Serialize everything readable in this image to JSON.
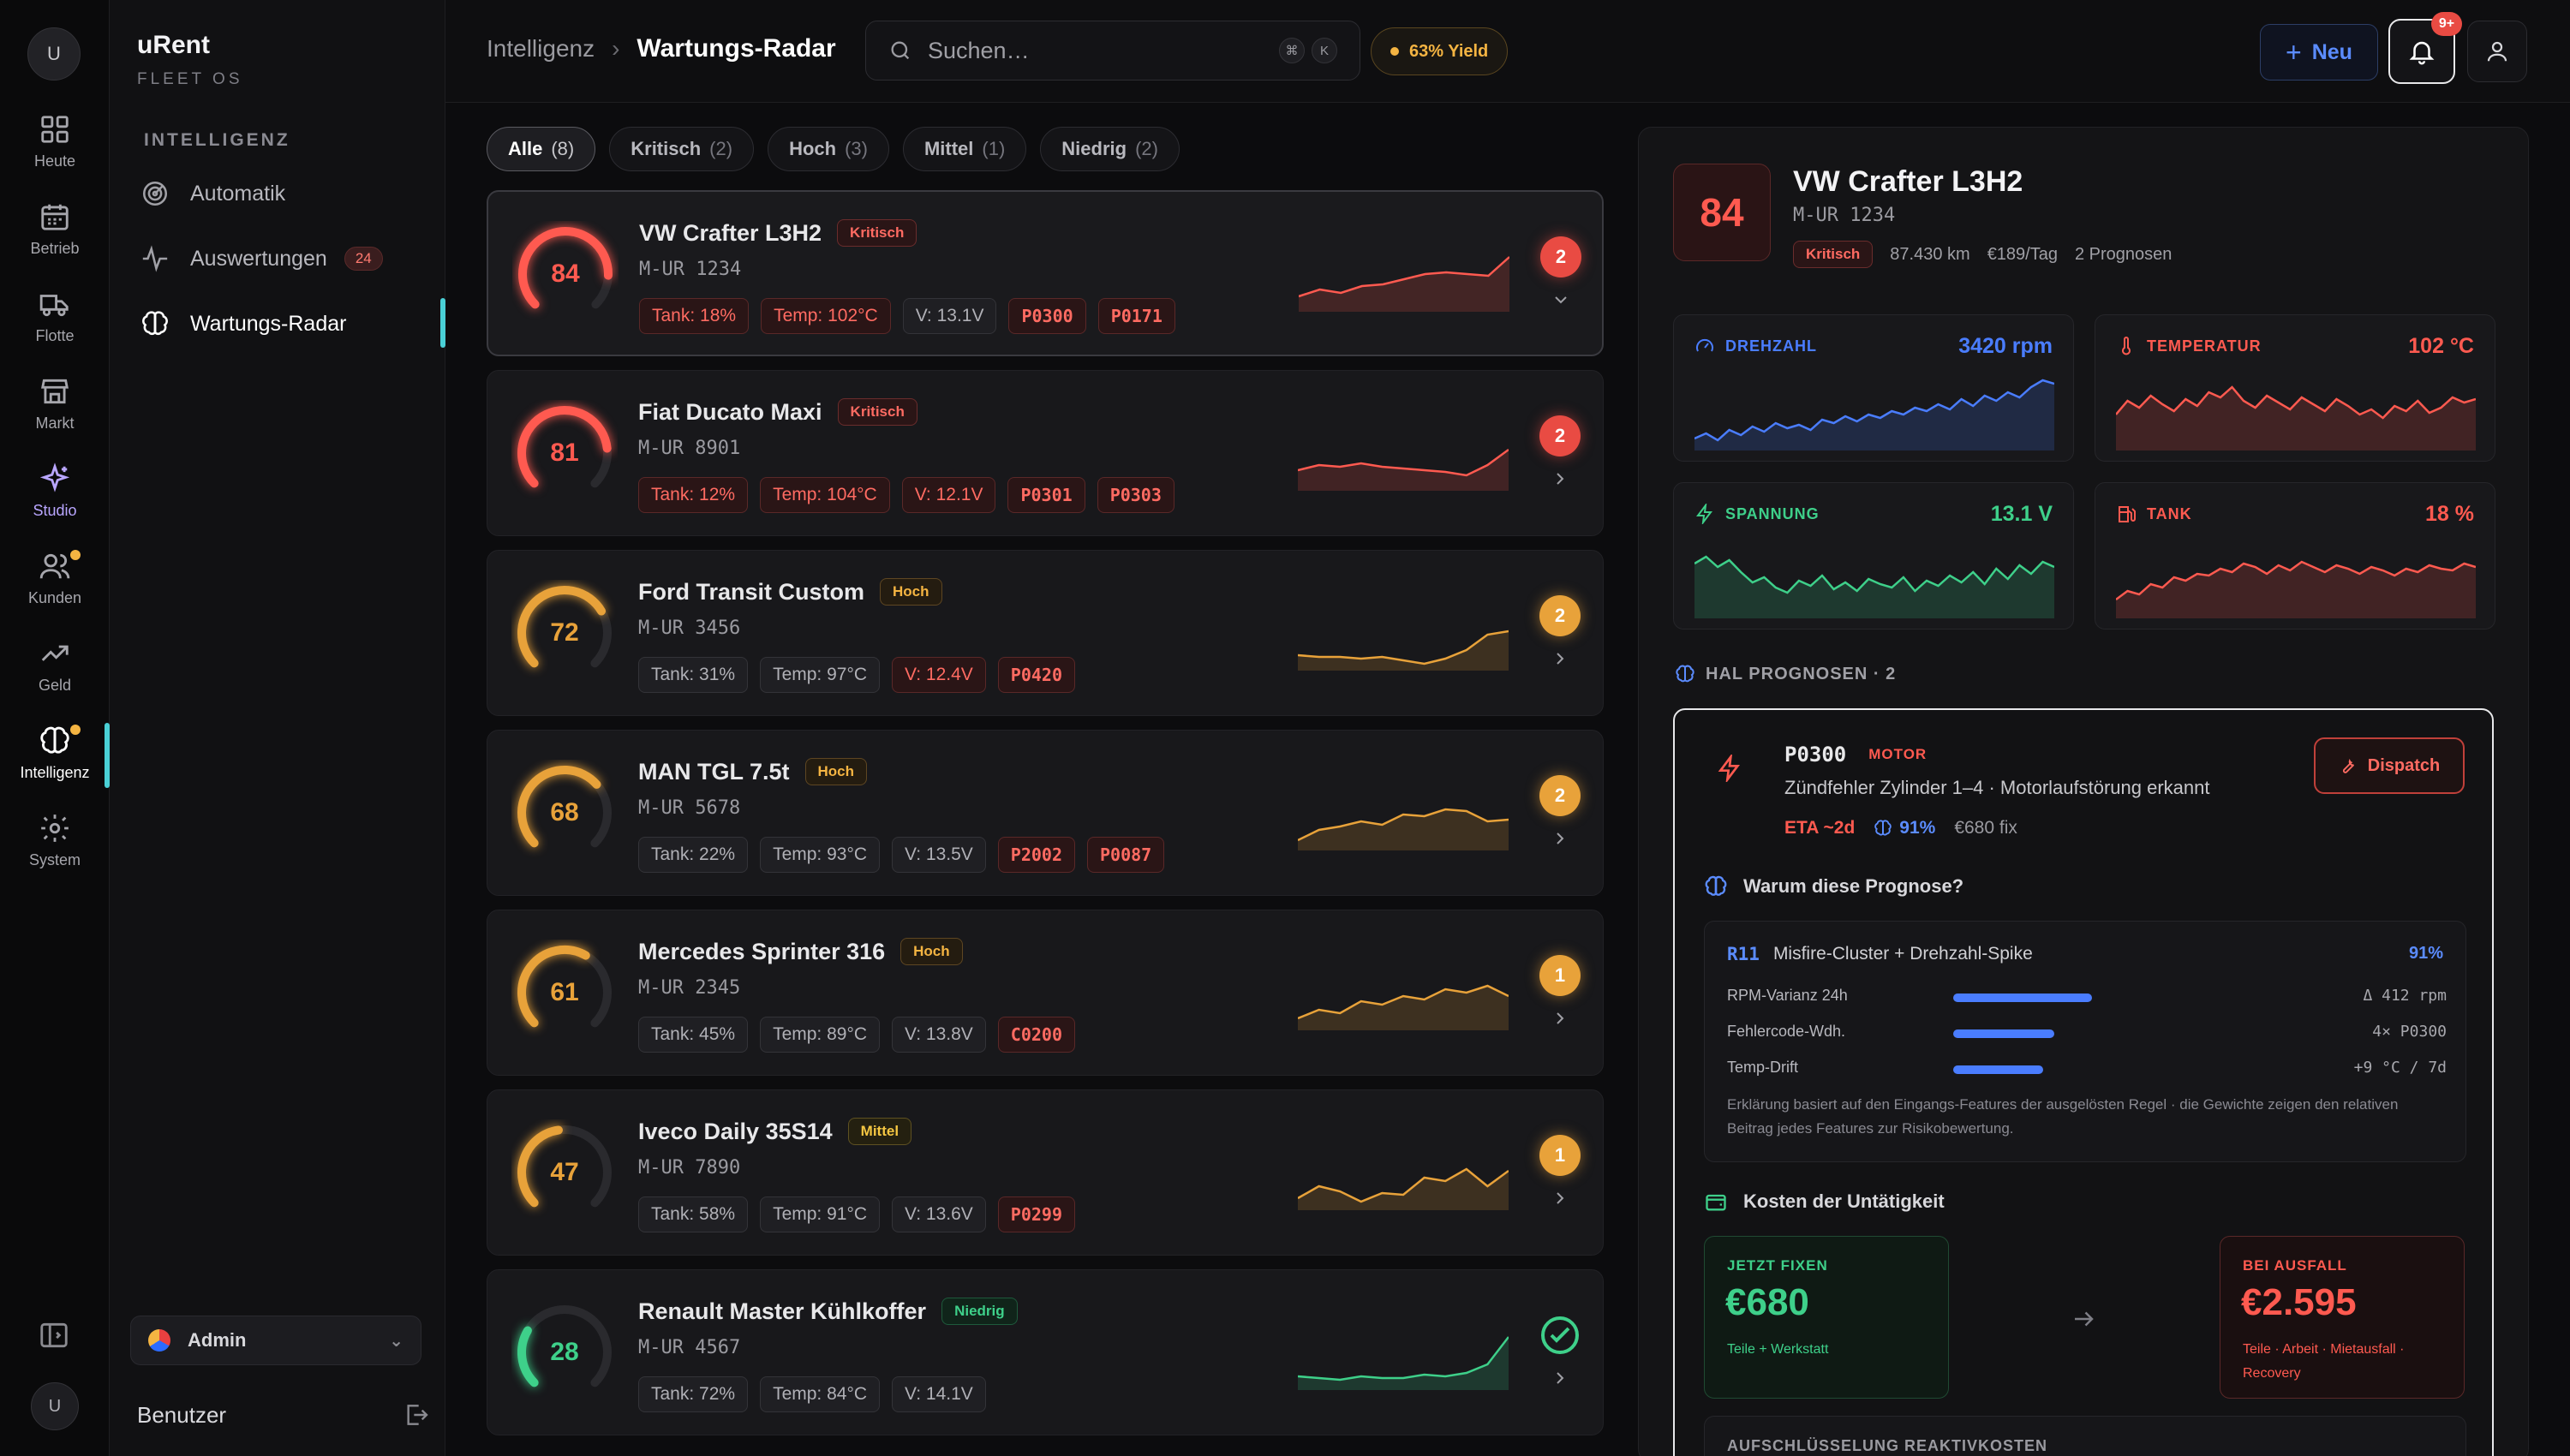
{
  "app": {
    "name": "uRent",
    "subtitle": "FLEET OS",
    "avatar_initial": "U"
  },
  "rail": [
    {
      "label": "Heute",
      "icon": "grid-icon"
    },
    {
      "label": "Betrieb",
      "icon": "calendar-icon"
    },
    {
      "label": "Flotte",
      "icon": "truck-icon"
    },
    {
      "label": "Markt",
      "icon": "store-icon"
    },
    {
      "label": "Studio",
      "icon": "sparkle-icon"
    },
    {
      "label": "Kunden",
      "icon": "users-icon"
    },
    {
      "label": "Geld",
      "icon": "trend-up-icon"
    },
    {
      "label": "Intelligenz",
      "icon": "brain-icon"
    },
    {
      "label": "System",
      "icon": "gear-icon"
    }
  ],
  "sidebar": {
    "section": "INTELLIGENZ",
    "items": [
      {
        "label": "Automatik",
        "icon": "radar-icon"
      },
      {
        "label": "Auswertungen",
        "icon": "activity-icon",
        "badge": "24"
      },
      {
        "label": "Wartungs-Radar",
        "icon": "brain-icon"
      }
    ],
    "role": "Admin",
    "user_label": "Benutzer",
    "user_initial": "U"
  },
  "topbar": {
    "breadcrumb_parent": "Intelligenz",
    "breadcrumb_current": "Wartungs-Radar",
    "search_placeholder": "Suchen…",
    "kbd_1": "⌘",
    "kbd_2": "K",
    "yield_label": "63% Yield",
    "new_label": "Neu",
    "notif_badge": "9+"
  },
  "filters": [
    {
      "label": "Alle",
      "count": "(8)"
    },
    {
      "label": "Kritisch",
      "count": "(2)"
    },
    {
      "label": "Hoch",
      "count": "(3)"
    },
    {
      "label": "Mittel",
      "count": "(1)"
    },
    {
      "label": "Niedrig",
      "count": "(2)"
    }
  ],
  "vehicles": [
    {
      "score": "84",
      "name": "VW Crafter L3H2",
      "severity": "Kritisch",
      "plate": "M-UR 1234",
      "tank": "Tank: 18%",
      "temp": "Temp: 102°C",
      "volt": "V: 13.1V",
      "codes": [
        "P0300",
        "P0171"
      ],
      "predictions": "2"
    },
    {
      "score": "81",
      "name": "Fiat Ducato Maxi",
      "severity": "Kritisch",
      "plate": "M-UR 8901",
      "tank": "Tank: 12%",
      "temp": "Temp: 104°C",
      "volt": "V: 12.1V",
      "codes": [
        "P0301",
        "P0303"
      ],
      "predictions": "2"
    },
    {
      "score": "72",
      "name": "Ford Transit Custom",
      "severity": "Hoch",
      "plate": "M-UR 3456",
      "tank": "Tank: 31%",
      "temp": "Temp: 97°C",
      "volt": "V: 12.4V",
      "codes": [
        "P0420"
      ],
      "predictions": "2"
    },
    {
      "score": "68",
      "name": "MAN TGL 7.5t",
      "severity": "Hoch",
      "plate": "M-UR 5678",
      "tank": "Tank: 22%",
      "temp": "Temp: 93°C",
      "volt": "V: 13.5V",
      "codes": [
        "P2002",
        "P0087"
      ],
      "predictions": "2"
    },
    {
      "score": "61",
      "name": "Mercedes Sprinter 316",
      "severity": "Hoch",
      "plate": "M-UR 2345",
      "tank": "Tank: 45%",
      "temp": "Temp: 89°C",
      "volt": "V: 13.8V",
      "codes": [
        "C0200"
      ],
      "predictions": "1"
    },
    {
      "score": "47",
      "name": "Iveco Daily 35S14",
      "severity": "Mittel",
      "plate": "M-UR 7890",
      "tank": "Tank: 58%",
      "temp": "Temp: 91°C",
      "volt": "V: 13.6V",
      "codes": [
        "P0299"
      ],
      "predictions": "1"
    },
    {
      "score": "28",
      "name": "Renault Master Kühlkoffer",
      "severity": "Niedrig",
      "plate": "M-UR 4567",
      "tank": "Tank: 72%",
      "temp": "Temp: 84°C",
      "volt": "V: 14.1V",
      "codes": [],
      "predictions": ""
    }
  ],
  "detail": {
    "score": "84",
    "name": "VW Crafter L3H2",
    "plate": "M-UR 1234",
    "severity": "Kritisch",
    "km": "87.430 km",
    "rate": "€189/Tag",
    "pred_count": "2 Prognosen",
    "metrics": [
      {
        "label": "DREHZAHL",
        "value": "3420 rpm",
        "color": "#4a7dff"
      },
      {
        "label": "TEMPERATUR",
        "value": "102 °C",
        "color": "#ff5a50"
      },
      {
        "label": "SPANNUNG",
        "value": "13.1 V",
        "color": "#3ed08a"
      },
      {
        "label": "TANK",
        "value": "18 %",
        "color": "#ff5a50"
      }
    ],
    "hal_heading": "HAL PROGNOSEN · 2",
    "prediction": {
      "code": "P0300",
      "category": "MOTOR",
      "description": "Zündfehler Zylinder 1–4 · Motorlaufstörung erkannt",
      "eta": "ETA ~2d",
      "confidence": "91%",
      "fix": "€680 fix",
      "dispatch_label": "Dispatch",
      "why_heading": "Warum diese Prognose?",
      "rule_id": "R11",
      "rule_name": "Misfire-Cluster + Drehzahl-Spike",
      "rule_pct": "91%",
      "features": [
        {
          "label": "RPM-Varianz 24h",
          "value": "Δ 412 rpm",
          "weight": 0.85
        },
        {
          "label": "Fehlercode-Wdh.",
          "value": "4× P0300",
          "weight": 0.62
        },
        {
          "label": "Temp-Drift",
          "value": "+9 °C / 7d",
          "weight": 0.55
        }
      ],
      "note": "Erklärung basiert auf den Eingangs-Features der ausgelösten Regel · die Gewichte zeigen den relativen Beitrag jedes Features zur Risikobewertung.",
      "cost_heading": "Kosten der Untätigkeit",
      "now_label": "JETZT FIXEN",
      "now_value": "€680",
      "now_sub": "Teile + Werkstatt",
      "fail_label": "BEI AUSFALL",
      "fail_value": "€2.595",
      "fail_sub": "Teile · Arbeit · Mietausfall · Recovery",
      "breakdown_label": "AUFSCHLÜSSELUNG REAKTIVKOSTEN"
    }
  },
  "colors": {
    "critical": "#ff5a50",
    "high": "#e8a23a",
    "low": "#3ed08a",
    "accent": "#4ad0d6",
    "blue": "#4a7dff"
  }
}
